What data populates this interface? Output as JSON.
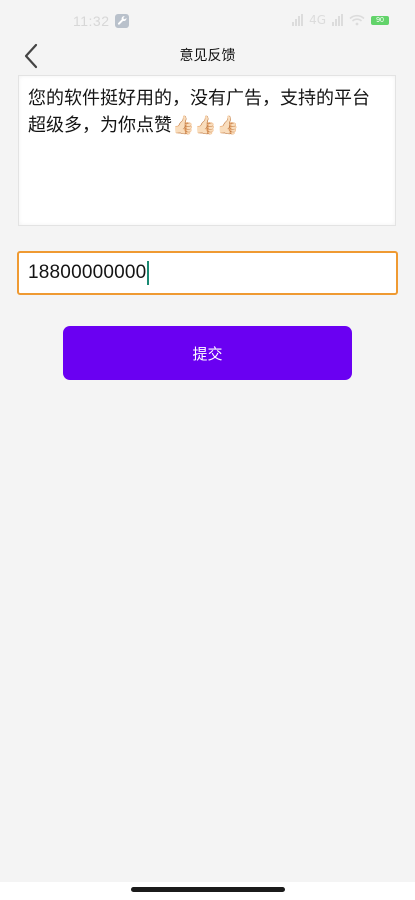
{
  "status_bar": {
    "time": "11:32",
    "battery_level": "90",
    "network_text": "4G"
  },
  "header": {
    "title": "意见反馈"
  },
  "feedback": {
    "text": "您的软件挺好用的，没有广告，支持的平台超级多，为你点赞👍🏻👍🏻👍🏻"
  },
  "phone_input": {
    "value": "18800000000"
  },
  "submit": {
    "label": "提交"
  },
  "colors": {
    "accent": "#6a00f2",
    "input_focus_border": "#ef9a32",
    "background": "#f4f4f4"
  },
  "icons": {
    "back": "chevron-left-icon",
    "status_tool": "wrench-icon",
    "battery": "battery-icon",
    "signal": "signal-icon",
    "wifi": "wifi-icon"
  }
}
